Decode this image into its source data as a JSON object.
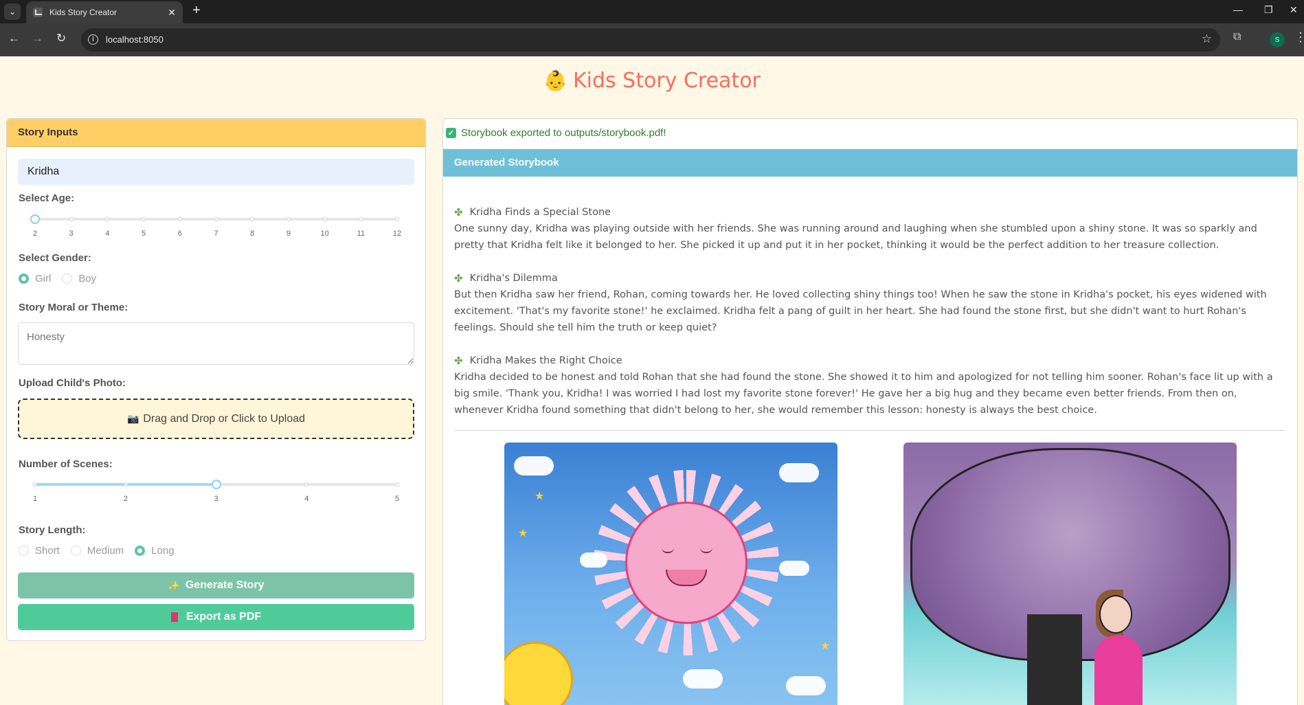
{
  "browser": {
    "tab_title": "Kids Story Creator",
    "url": "localhost:8050",
    "profile_initial": "S"
  },
  "page": {
    "title": "Kids Story Creator",
    "title_emoji": "👶"
  },
  "inputs": {
    "header": "Story Inputs",
    "name_value": "Kridha",
    "age_label": "Select Age:",
    "age_marks": [
      "2",
      "3",
      "4",
      "5",
      "6",
      "7",
      "8",
      "9",
      "10",
      "11",
      "12"
    ],
    "age_value": 2,
    "gender_label": "Select Gender:",
    "gender_options": [
      "Girl",
      "Boy"
    ],
    "gender_selected": "Girl",
    "moral_label": "Story Moral or Theme:",
    "moral_placeholder": "Honesty",
    "photo_label": "Upload Child's Photo:",
    "upload_text": "Drag and Drop or Click to Upload",
    "upload_icon": "camera-icon",
    "scenes_label": "Number of Scenes:",
    "scenes_marks": [
      "1",
      "2",
      "3",
      "4",
      "5"
    ],
    "scenes_value": 3,
    "length_label": "Story Length:",
    "length_options": [
      "Short",
      "Medium",
      "Long"
    ],
    "length_selected": "Long",
    "generate_button": "Generate Story",
    "generate_icon": "sparkles-icon",
    "export_button": "Export as PDF",
    "export_icon": "book-icon"
  },
  "output": {
    "success_message": "Storybook exported to outputs/storybook.pdf!",
    "header": "Generated Storybook",
    "scenes": [
      {
        "title": "Kridha Finds a Special Stone",
        "text": "One sunny day, Kridha was playing outside with her friends. She was running around and laughing when she stumbled upon a shiny stone. It was so sparkly and pretty that Kridha felt like it belonged to her. She picked it up and put it in her pocket, thinking it would be the perfect addition to her treasure collection."
      },
      {
        "title": "Kridha's Dilemma",
        "text": "But then Kridha saw her friend, Rohan, coming towards her. He loved collecting shiny things too! When he saw the stone in Kridha's pocket, his eyes widened with excitement. 'That's my favorite stone!' he exclaimed. Kridha felt a pang of guilt in her heart. She had found the stone first, but she didn't want to hurt Rohan's feelings. Should she tell him the truth or keep quiet?"
      },
      {
        "title": "Kridha Makes the Right Choice",
        "text": "Kridha decided to be honest and told Rohan that she had found the stone. She showed it to him and apologized for not telling him sooner. Rohan's face lit up with a big smile. 'Thank you, Kridha! I was worried I had lost my favorite stone forever!' He gave her a big hug and they became even better friends. From then on, whenever Kridha found something that didn't belong to her, she would remember this lesson: honesty is always the best choice."
      }
    ]
  },
  "colors": {
    "page_bg": "#fff8e7",
    "title": "#ff6b5b",
    "inputs_header": "#ffcf66",
    "output_header": "#6ec0d8",
    "generate_button": "#7cc3aa",
    "export_button": "#4fcb9a",
    "radio_checked": "#5cc3a4",
    "slider_accent": "#9fd8f5"
  }
}
